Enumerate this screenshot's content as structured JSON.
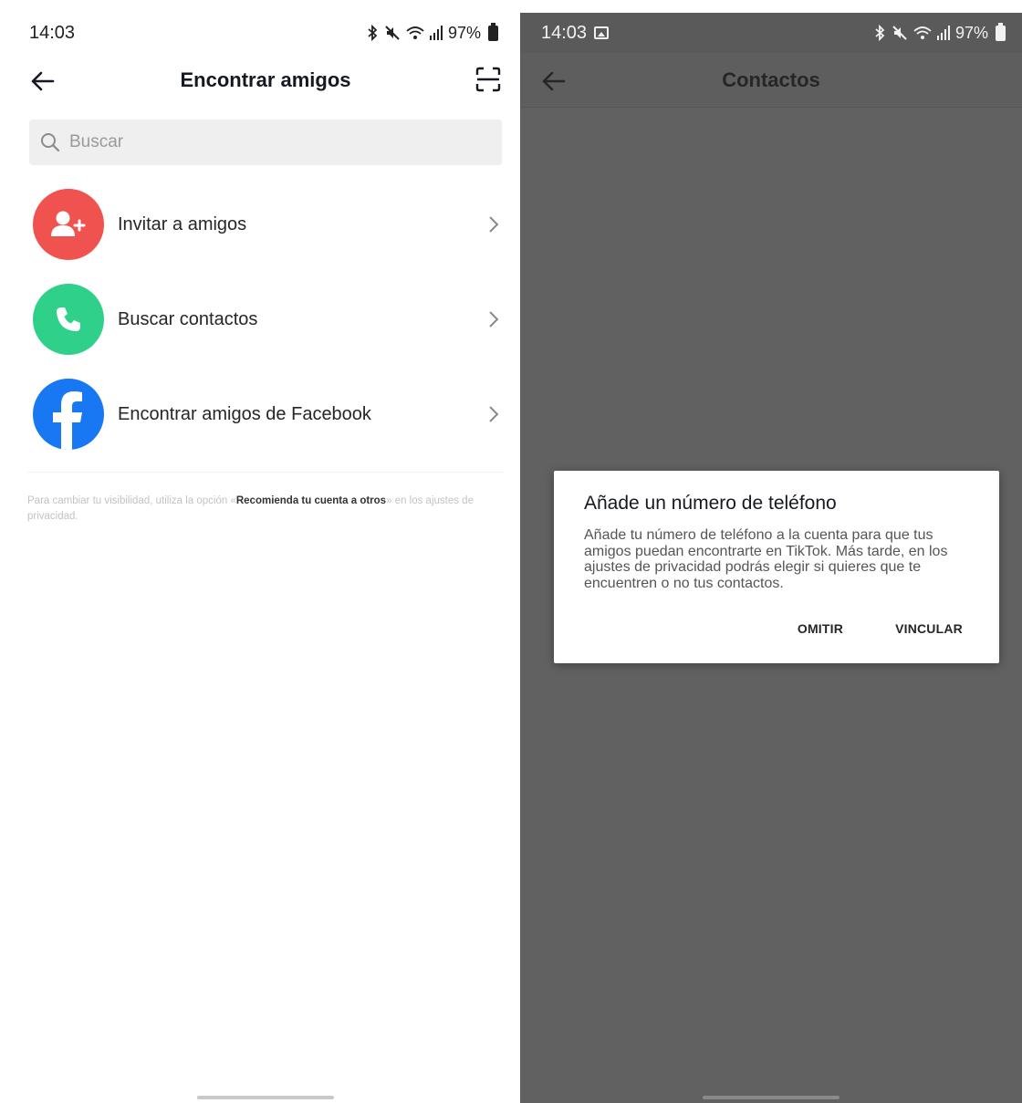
{
  "left_screen": {
    "status_bar": {
      "time": "14:03",
      "battery": "97%"
    },
    "nav": {
      "title": "Encontrar amigos"
    },
    "search": {
      "placeholder": "Buscar"
    },
    "items": [
      {
        "label": "Invitar a amigos",
        "icon": "add-person-icon",
        "color": "#f0524f"
      },
      {
        "label": "Buscar contactos",
        "icon": "phone-icon",
        "color": "#2fd08a"
      },
      {
        "label": "Encontrar amigos de Facebook",
        "icon": "facebook-icon",
        "color": "#1877f2"
      }
    ],
    "privacy_note": {
      "before": "Para cambiar tu visibilidad, utiliza la opción «",
      "bold": "Recomienda tu cuenta a otros",
      "after": "» en los ajustes de privacidad."
    }
  },
  "right_screen": {
    "status_bar": {
      "time": "14:03",
      "battery": "97%"
    },
    "nav": {
      "title": "Contactos"
    },
    "dialog": {
      "title": "Añade un número de teléfono",
      "body": "Añade tu número de teléfono a la cuenta para que tus amigos puedan encontrarte en TikTok. Más tarde, en los ajustes de privacidad podrás elegir si quieres que te encuentren o no tus contactos.",
      "skip_label": "OMITIR",
      "link_label": "VINCULAR"
    }
  },
  "colors": {
    "overlay": "#616161",
    "search_bg": "#efefef",
    "text_primary": "#161823"
  }
}
